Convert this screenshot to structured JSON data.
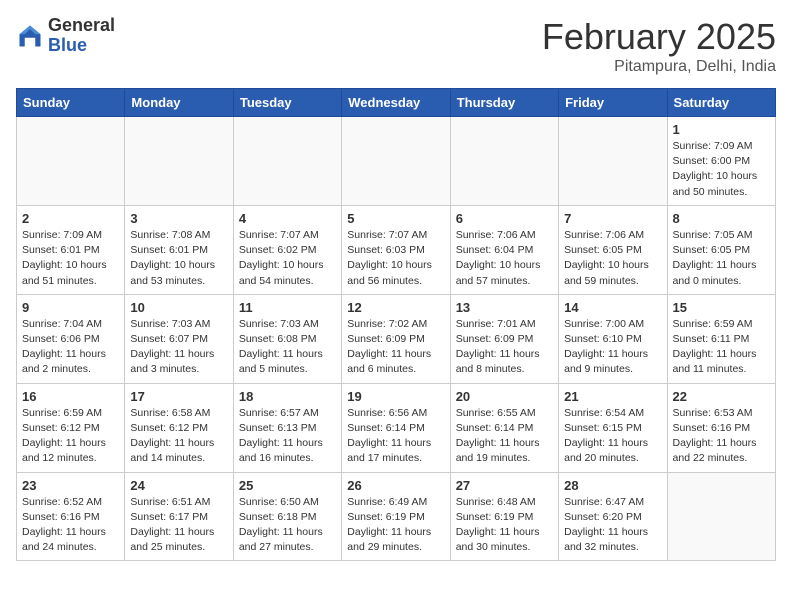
{
  "header": {
    "logo_general": "General",
    "logo_blue": "Blue",
    "month_title": "February 2025",
    "subtitle": "Pitampura, Delhi, India"
  },
  "weekdays": [
    "Sunday",
    "Monday",
    "Tuesday",
    "Wednesday",
    "Thursday",
    "Friday",
    "Saturday"
  ],
  "weeks": [
    [
      {
        "day": "",
        "info": ""
      },
      {
        "day": "",
        "info": ""
      },
      {
        "day": "",
        "info": ""
      },
      {
        "day": "",
        "info": ""
      },
      {
        "day": "",
        "info": ""
      },
      {
        "day": "",
        "info": ""
      },
      {
        "day": "1",
        "info": "Sunrise: 7:09 AM\nSunset: 6:00 PM\nDaylight: 10 hours\nand 50 minutes."
      }
    ],
    [
      {
        "day": "2",
        "info": "Sunrise: 7:09 AM\nSunset: 6:01 PM\nDaylight: 10 hours\nand 51 minutes."
      },
      {
        "day": "3",
        "info": "Sunrise: 7:08 AM\nSunset: 6:01 PM\nDaylight: 10 hours\nand 53 minutes."
      },
      {
        "day": "4",
        "info": "Sunrise: 7:07 AM\nSunset: 6:02 PM\nDaylight: 10 hours\nand 54 minutes."
      },
      {
        "day": "5",
        "info": "Sunrise: 7:07 AM\nSunset: 6:03 PM\nDaylight: 10 hours\nand 56 minutes."
      },
      {
        "day": "6",
        "info": "Sunrise: 7:06 AM\nSunset: 6:04 PM\nDaylight: 10 hours\nand 57 minutes."
      },
      {
        "day": "7",
        "info": "Sunrise: 7:06 AM\nSunset: 6:05 PM\nDaylight: 10 hours\nand 59 minutes."
      },
      {
        "day": "8",
        "info": "Sunrise: 7:05 AM\nSunset: 6:05 PM\nDaylight: 11 hours\nand 0 minutes."
      }
    ],
    [
      {
        "day": "9",
        "info": "Sunrise: 7:04 AM\nSunset: 6:06 PM\nDaylight: 11 hours\nand 2 minutes."
      },
      {
        "day": "10",
        "info": "Sunrise: 7:03 AM\nSunset: 6:07 PM\nDaylight: 11 hours\nand 3 minutes."
      },
      {
        "day": "11",
        "info": "Sunrise: 7:03 AM\nSunset: 6:08 PM\nDaylight: 11 hours\nand 5 minutes."
      },
      {
        "day": "12",
        "info": "Sunrise: 7:02 AM\nSunset: 6:09 PM\nDaylight: 11 hours\nand 6 minutes."
      },
      {
        "day": "13",
        "info": "Sunrise: 7:01 AM\nSunset: 6:09 PM\nDaylight: 11 hours\nand 8 minutes."
      },
      {
        "day": "14",
        "info": "Sunrise: 7:00 AM\nSunset: 6:10 PM\nDaylight: 11 hours\nand 9 minutes."
      },
      {
        "day": "15",
        "info": "Sunrise: 6:59 AM\nSunset: 6:11 PM\nDaylight: 11 hours\nand 11 minutes."
      }
    ],
    [
      {
        "day": "16",
        "info": "Sunrise: 6:59 AM\nSunset: 6:12 PM\nDaylight: 11 hours\nand 12 minutes."
      },
      {
        "day": "17",
        "info": "Sunrise: 6:58 AM\nSunset: 6:12 PM\nDaylight: 11 hours\nand 14 minutes."
      },
      {
        "day": "18",
        "info": "Sunrise: 6:57 AM\nSunset: 6:13 PM\nDaylight: 11 hours\nand 16 minutes."
      },
      {
        "day": "19",
        "info": "Sunrise: 6:56 AM\nSunset: 6:14 PM\nDaylight: 11 hours\nand 17 minutes."
      },
      {
        "day": "20",
        "info": "Sunrise: 6:55 AM\nSunset: 6:14 PM\nDaylight: 11 hours\nand 19 minutes."
      },
      {
        "day": "21",
        "info": "Sunrise: 6:54 AM\nSunset: 6:15 PM\nDaylight: 11 hours\nand 20 minutes."
      },
      {
        "day": "22",
        "info": "Sunrise: 6:53 AM\nSunset: 6:16 PM\nDaylight: 11 hours\nand 22 minutes."
      }
    ],
    [
      {
        "day": "23",
        "info": "Sunrise: 6:52 AM\nSunset: 6:16 PM\nDaylight: 11 hours\nand 24 minutes."
      },
      {
        "day": "24",
        "info": "Sunrise: 6:51 AM\nSunset: 6:17 PM\nDaylight: 11 hours\nand 25 minutes."
      },
      {
        "day": "25",
        "info": "Sunrise: 6:50 AM\nSunset: 6:18 PM\nDaylight: 11 hours\nand 27 minutes."
      },
      {
        "day": "26",
        "info": "Sunrise: 6:49 AM\nSunset: 6:19 PM\nDaylight: 11 hours\nand 29 minutes."
      },
      {
        "day": "27",
        "info": "Sunrise: 6:48 AM\nSunset: 6:19 PM\nDaylight: 11 hours\nand 30 minutes."
      },
      {
        "day": "28",
        "info": "Sunrise: 6:47 AM\nSunset: 6:20 PM\nDaylight: 11 hours\nand 32 minutes."
      },
      {
        "day": "",
        "info": ""
      }
    ]
  ]
}
